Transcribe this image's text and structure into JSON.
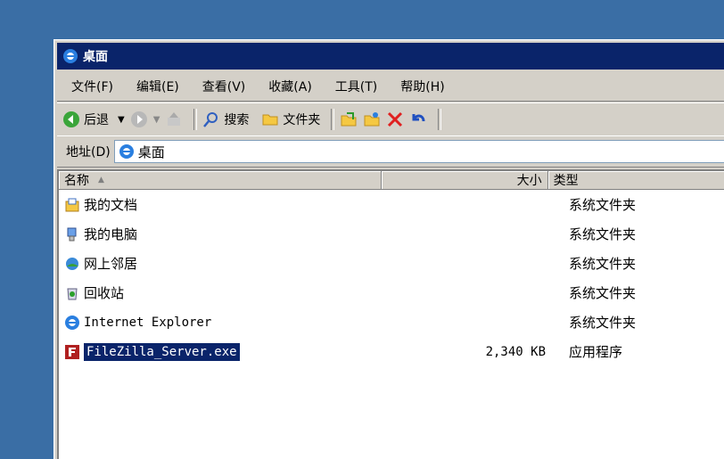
{
  "window": {
    "title": "桌面"
  },
  "menu": [
    "文件(F)",
    "编辑(E)",
    "查看(V)",
    "收藏(A)",
    "工具(T)",
    "帮助(H)"
  ],
  "toolbar": {
    "back": "后退",
    "search": "搜索",
    "folders": "文件夹"
  },
  "address": {
    "label": "地址(D)",
    "value": "桌面"
  },
  "columns": {
    "name": "名称",
    "size": "大小",
    "type": "类型"
  },
  "items": [
    {
      "name": "我的文档",
      "size": "",
      "type": "系统文件夹",
      "icon": "my-documents-icon"
    },
    {
      "name": "我的电脑",
      "size": "",
      "type": "系统文件夹",
      "icon": "my-computer-icon"
    },
    {
      "name": "网上邻居",
      "size": "",
      "type": "系统文件夹",
      "icon": "network-icon"
    },
    {
      "name": "回收站",
      "size": "",
      "type": "系统文件夹",
      "icon": "recycle-bin-icon"
    },
    {
      "name": "Internet Explorer",
      "size": "",
      "type": "系统文件夹",
      "icon": "ie-icon"
    },
    {
      "name": "FileZilla_Server.exe",
      "size": "2,340 KB",
      "type": "应用程序",
      "icon": "filezilla-icon"
    }
  ],
  "colors": {
    "desktop": "#3a6ea5",
    "titlebar": "#0a246a",
    "selection": "#0a246a"
  }
}
